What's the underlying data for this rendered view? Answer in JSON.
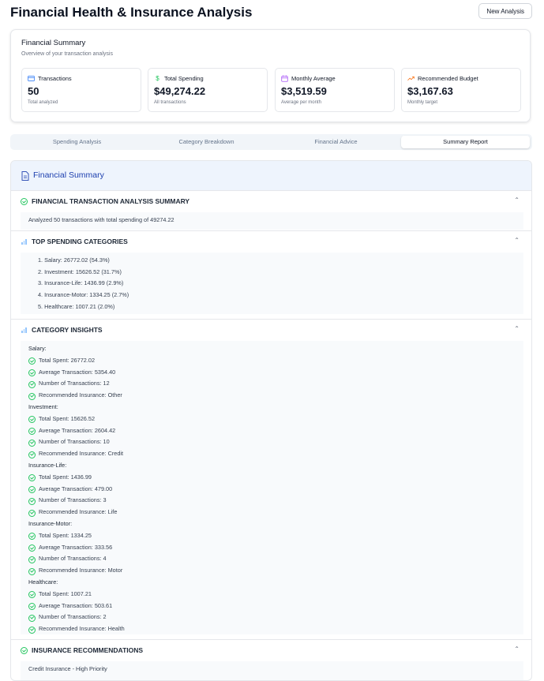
{
  "header": {
    "title": "Financial Health & Insurance Analysis",
    "new_button": "New Analysis"
  },
  "summary": {
    "title": "Financial Summary",
    "subtitle": "Overview of your transaction analysis",
    "stats": [
      {
        "label": "Transactions",
        "value": "50",
        "note": "Total analyzed",
        "icon": "credit-card-icon",
        "color": "#3b82f6"
      },
      {
        "label": "Total Spending",
        "value": "$49,274.22",
        "note": "All transactions",
        "icon": "dollar-icon",
        "color": "#22c55e"
      },
      {
        "label": "Monthly Average",
        "value": "$3,519.59",
        "note": "Average per month",
        "icon": "calendar-icon",
        "color": "#a855f7"
      },
      {
        "label": "Recommended Budget",
        "value": "$3,167.63",
        "note": "Monthly target",
        "icon": "trending-up-icon",
        "color": "#f97316"
      }
    ]
  },
  "tabs": [
    {
      "label": "Spending Analysis",
      "active": false
    },
    {
      "label": "Category Breakdown",
      "active": false
    },
    {
      "label": "Financial Advice",
      "active": false
    },
    {
      "label": "Summary Report",
      "active": true
    }
  ],
  "report": {
    "title": "Financial Summary",
    "sections": {
      "overview": {
        "title": "FINANCIAL TRANSACTION ANALYSIS SUMMARY",
        "text": "Analyzed 50 transactions with total spending of 49274.22"
      },
      "top": {
        "title": "TOP SPENDING CATEGORIES",
        "items": [
          "1. Salary: 26772.02 (54.3%)",
          "2. Investment: 15626.52 (31.7%)",
          "3. Insurance-Life: 1436.99 (2.9%)",
          "4. Insurance-Motor: 1334.25 (2.7%)",
          "5. Healthcare: 1007.21 (2.0%)"
        ]
      },
      "insights": {
        "title": "CATEGORY INSIGHTS",
        "groups": [
          {
            "name": "Salary:",
            "items": [
              "Total Spent: 26772.02",
              "Average Transaction: 5354.40",
              "Number of Transactions: 12",
              "Recommended Insurance: Other"
            ]
          },
          {
            "name": "Investment:",
            "items": [
              "Total Spent: 15626.52",
              "Average Transaction: 2604.42",
              "Number of Transactions: 10",
              "Recommended Insurance: Credit"
            ]
          },
          {
            "name": "Insurance-Life:",
            "items": [
              "Total Spent: 1436.99",
              "Average Transaction: 479.00",
              "Number of Transactions: 3",
              "Recommended Insurance: Life"
            ]
          },
          {
            "name": "Insurance-Motor:",
            "items": [
              "Total Spent: 1334.25",
              "Average Transaction: 333.56",
              "Number of Transactions: 4",
              "Recommended Insurance: Motor"
            ]
          },
          {
            "name": "Healthcare:",
            "items": [
              "Total Spent: 1007.21",
              "Average Transaction: 503.61",
              "Number of Transactions: 2",
              "Recommended Insurance: Health"
            ]
          }
        ]
      },
      "recs": {
        "title": "INSURANCE RECOMMENDATIONS",
        "first": "Credit Insurance - High Priority"
      }
    }
  },
  "colors": {
    "accent": "#1e40af",
    "check": "#22c55e",
    "header_bg": "#eef4fd"
  }
}
